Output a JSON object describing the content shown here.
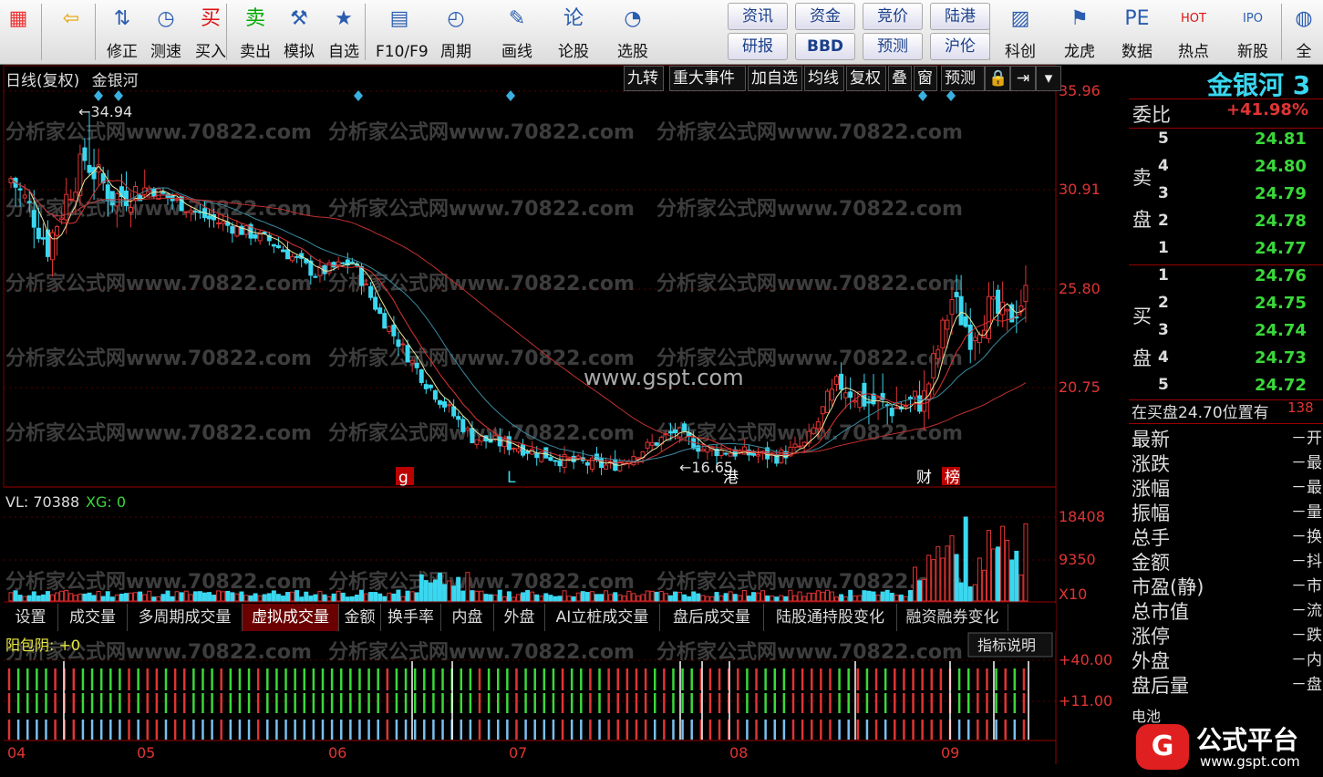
{
  "toolbar": {
    "buttons": [
      {
        "label": "",
        "icon": "windows-icon"
      },
      {
        "label": "",
        "icon": "back-arrow-icon"
      },
      {
        "label": "修正",
        "icon": "up-down-arrows-icon"
      },
      {
        "label": "测速",
        "icon": "clock-icon"
      },
      {
        "label": "买入",
        "icon": "buy-icon",
        "glyph": "买"
      },
      {
        "label": "卖出",
        "icon": "sell-icon",
        "glyph": "卖"
      },
      {
        "label": "模拟",
        "icon": "hammer-icon"
      },
      {
        "label": "自选",
        "icon": "star-icon"
      },
      {
        "label": "F10/F9",
        "icon": "document-icon"
      },
      {
        "label": "周期",
        "icon": "period-icon"
      },
      {
        "label": "画线",
        "icon": "pen-icon"
      },
      {
        "label": "论股",
        "icon": "talk-icon"
      },
      {
        "label": "选股",
        "icon": "chart-search-icon"
      },
      {
        "label": "科创",
        "icon": "kechuang-icon"
      },
      {
        "label": "龙虎",
        "icon": "dragon-icon"
      },
      {
        "label": "数据",
        "icon": "pe-icon",
        "glyph": "PE"
      },
      {
        "label": "热点",
        "icon": "hot-icon",
        "glyph": "HOT"
      },
      {
        "label": "新股",
        "icon": "ipo-icon",
        "glyph": "IPO"
      },
      {
        "label": "全",
        "icon": "globe-icon"
      }
    ],
    "small_buttons": [
      "资讯",
      "资金",
      "竞价",
      "陆港",
      "研报",
      "BBD",
      "预测",
      "沪伦"
    ]
  },
  "chart": {
    "title": "日线(复权)",
    "stock_name": "金银河",
    "top_buttons": [
      "九转",
      "重大事件",
      "加自选",
      "均线",
      "复权",
      "叠",
      "窗",
      "预测"
    ],
    "price_ticks": [
      "35.96",
      "30.91",
      "25.80",
      "20.75"
    ],
    "volume_ticks": [
      "18408",
      "9350"
    ],
    "volume_unit": "X10",
    "indicator_ticks": [
      "+40.00",
      "+11.00"
    ],
    "high_label": "34.94",
    "low_label": "16.65",
    "markers": [
      "g",
      "L",
      "港",
      "财",
      "榜"
    ],
    "x_months": [
      "04",
      "05",
      "06",
      "07",
      "08",
      "09"
    ],
    "volume_label": "VL: 70388",
    "xg_label": "XG: 0",
    "indicator_name": "阳包阴: +0",
    "indicator_help": "指标说明",
    "watermark": "分析家公式网www.70822.com",
    "watermark2": "www.gspt.com"
  },
  "tabs": [
    "设置",
    "成交量",
    "多周期成交量",
    "虚拟成交量",
    "金额",
    "换手率",
    "内盘",
    "外盘",
    "AI立桩成交量",
    "盘后成交量",
    "陆股通持股变化",
    "融资融券变化"
  ],
  "active_tab": "虚拟成交量",
  "orderbook": {
    "header": "金银河 3",
    "weibi_label": "委比",
    "weibi_value": "+41.98%",
    "sell_label": "卖盘",
    "buy_label": "买盘",
    "sells": [
      {
        "n": "5",
        "p": "24.81"
      },
      {
        "n": "4",
        "p": "24.80"
      },
      {
        "n": "3",
        "p": "24.79"
      },
      {
        "n": "2",
        "p": "24.78"
      },
      {
        "n": "1",
        "p": "24.77"
      }
    ],
    "buys": [
      {
        "n": "1",
        "p": "24.76"
      },
      {
        "n": "2",
        "p": "24.75"
      },
      {
        "n": "3",
        "p": "24.74"
      },
      {
        "n": "4",
        "p": "24.73"
      },
      {
        "n": "5",
        "p": "24.72"
      }
    ],
    "buy_note": "在买盘24.70位置有",
    "buy_note_value": "138",
    "stats": [
      {
        "k": "最新",
        "v": "－开"
      },
      {
        "k": "涨跌",
        "v": "－最"
      },
      {
        "k": "涨幅",
        "v": "－最"
      },
      {
        "k": "振幅",
        "v": "－量"
      },
      {
        "k": "总手",
        "v": "－换"
      },
      {
        "k": "金额",
        "v": "－抖"
      },
      {
        "k": "市盈(静)",
        "v": "－市"
      },
      {
        "k": "总市值",
        "v": "－流"
      },
      {
        "k": "涨停",
        "v": "－跌"
      },
      {
        "k": "外盘",
        "v": "－内"
      },
      {
        "k": "盘后量",
        "v": "－盘"
      }
    ],
    "bottom_label": "电池"
  },
  "logo": {
    "text": "公式平台",
    "url": "www.gspt.com"
  },
  "colors": {
    "up": "#e03434",
    "down": "#3ad8f0",
    "ma5": "#e8e8a0",
    "ma10": "#e03434",
    "ma20": "#3a8aa0",
    "ma60": "#c03030"
  }
}
